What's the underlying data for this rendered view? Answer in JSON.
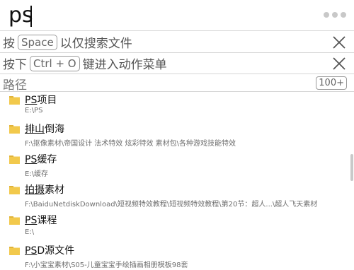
{
  "search": {
    "value": "ps"
  },
  "hints": [
    {
      "prefix": "按",
      "key": "Space",
      "suffix": "以仅搜索文件"
    },
    {
      "prefix": "按下",
      "key": "Ctrl + O",
      "suffix": "键进入动作菜单"
    }
  ],
  "path_header": {
    "label": "路径",
    "count": "100+"
  },
  "results": [
    {
      "name_hl": "PS",
      "name_rest": "项目",
      "path": "E:\\PS"
    },
    {
      "name_hl": "排山",
      "name_rest": "倒海",
      "path": "F:\\抠像素材\\帝国设计 法术特效 炫彩特效 素材包\\各种游戏技能特效"
    },
    {
      "name_hl": "PS",
      "name_rest": "缓存",
      "path": "E:\\缓存"
    },
    {
      "name_hl": "拍摄",
      "name_rest": "素材",
      "path": "F:\\BaiduNetdiskDownload\\短视频特效教程\\短视频特效教程\\第20节：超人...\\超人飞天素材"
    },
    {
      "name_hl": "PS",
      "name_rest": "课程",
      "path": "E:\\"
    },
    {
      "name_hl": "PS",
      "name_rest": "D源文件",
      "path": "F:\\小宝宝素材\\S05-儿童宝宝手绘插画相册模板98套"
    }
  ],
  "colors": {
    "folder": "#f2c94c",
    "folder_tab": "#e0b33a",
    "divider": "#d6d6d6"
  },
  "icons": {
    "more": "more-dots-icon",
    "close": "close-icon",
    "folder": "folder-icon"
  }
}
